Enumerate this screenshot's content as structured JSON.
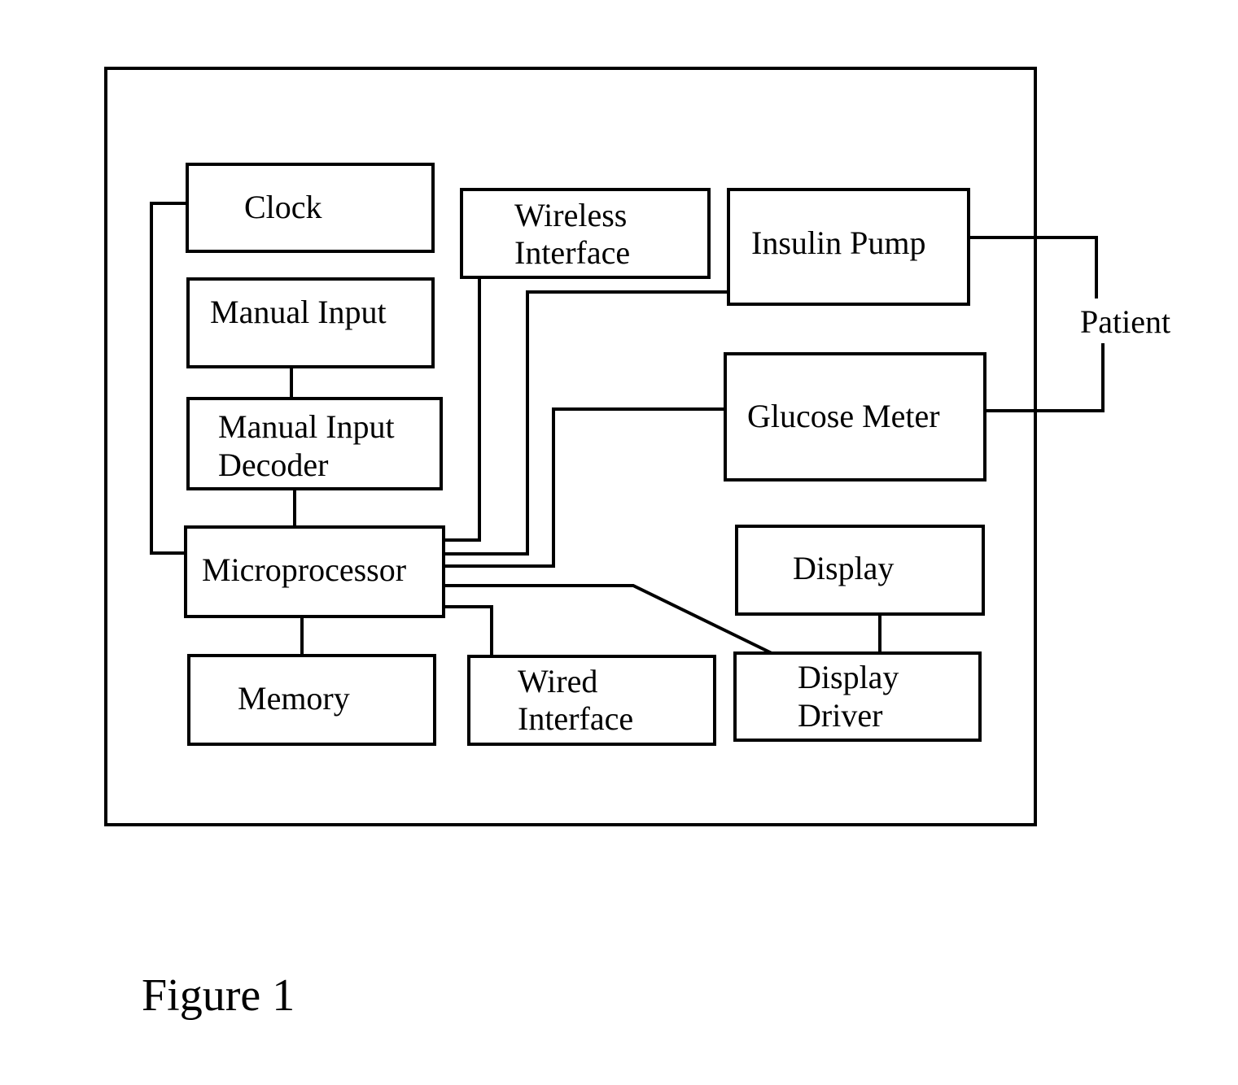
{
  "diagram": {
    "title": "Figure 1",
    "colors": {
      "stroke": "#000000",
      "background": "#ffffff"
    },
    "blocks": {
      "clock": [
        "Clock"
      ],
      "manual_input": [
        "Manual Input"
      ],
      "manual_input_decoder": [
        "Manual Input",
        "Decoder"
      ],
      "microprocessor": [
        "Microprocessor"
      ],
      "memory": [
        "Memory"
      ],
      "wireless_interface": [
        "Wireless",
        "Interface"
      ],
      "wired_interface": [
        "Wired",
        "Interface"
      ],
      "insulin_pump": [
        "Insulin Pump"
      ],
      "glucose_meter": [
        "Glucose Meter"
      ],
      "display": [
        "Display"
      ],
      "display_driver": [
        "Display",
        "Driver"
      ]
    },
    "external": {
      "patient": "Patient"
    },
    "connections": [
      [
        "clock",
        "microprocessor"
      ],
      [
        "manual_input",
        "manual_input_decoder"
      ],
      [
        "manual_input_decoder",
        "microprocessor"
      ],
      [
        "microprocessor",
        "memory"
      ],
      [
        "microprocessor",
        "wireless_interface"
      ],
      [
        "microprocessor",
        "insulin_pump"
      ],
      [
        "microprocessor",
        "glucose_meter"
      ],
      [
        "microprocessor",
        "display_driver"
      ],
      [
        "microprocessor",
        "wired_interface"
      ],
      [
        "display",
        "display_driver"
      ],
      [
        "insulin_pump",
        "patient"
      ],
      [
        "glucose_meter",
        "patient"
      ]
    ]
  }
}
